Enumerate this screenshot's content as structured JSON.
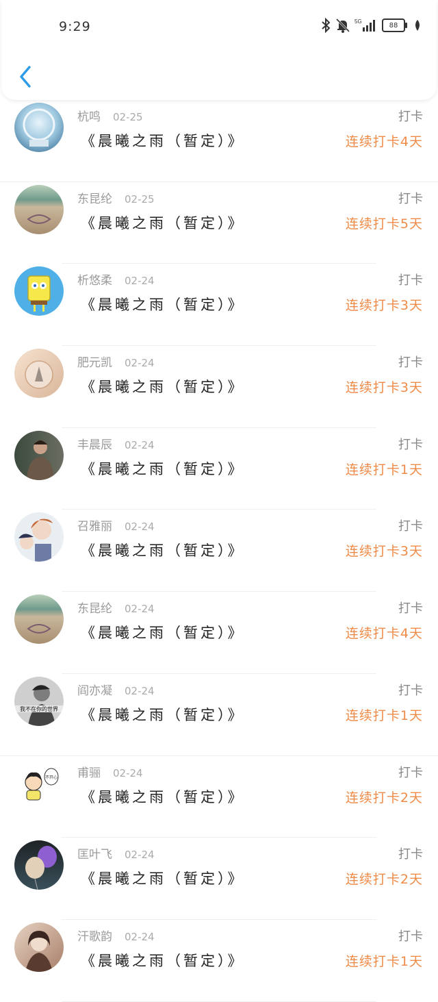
{
  "status_bar": {
    "time": "9:29",
    "network": "5G",
    "battery": "88"
  },
  "header": {
    "back_icon": "chevron-left-icon"
  },
  "colors": {
    "streak": "#ef8b48",
    "back": "#2e9be6"
  },
  "items": [
    {
      "name": "杭鸣",
      "date": "02-25",
      "title": "《晨曦之雨（暂定）》",
      "checkin": "打卡",
      "streak": "连续打卡4天",
      "avatar": "crystal-ball"
    },
    {
      "name": "东昆纶",
      "date": "02-25",
      "title": "《晨曦之雨（暂定）》",
      "checkin": "打卡",
      "streak": "连续打卡5天",
      "avatar": "beach-heart"
    },
    {
      "name": "析悠柔",
      "date": "02-24",
      "title": "《晨曦之雨（暂定）》",
      "checkin": "打卡",
      "streak": "连续打卡3天",
      "avatar": "sponge-cartoon"
    },
    {
      "name": "肥元凯",
      "date": "02-24",
      "title": "《晨曦之雨（暂定）》",
      "checkin": "打卡",
      "streak": "连续打卡3天",
      "avatar": "glass-jar"
    },
    {
      "name": "丰晨辰",
      "date": "02-24",
      "title": "《晨曦之雨（暂定）》",
      "checkin": "打卡",
      "streak": "连续打卡1天",
      "avatar": "man-portrait"
    },
    {
      "name": "召雅丽",
      "date": "02-24",
      "title": "《晨曦之雨（暂定）》",
      "checkin": "打卡",
      "streak": "连续打卡3天",
      "avatar": "anime-boys"
    },
    {
      "name": "东昆纶",
      "date": "02-24",
      "title": "《晨曦之雨（暂定）》",
      "checkin": "打卡",
      "streak": "连续打卡4天",
      "avatar": "beach-heart"
    },
    {
      "name": "阎亦凝",
      "date": "02-24",
      "title": "《晨曦之雨（暂定）》",
      "checkin": "打卡",
      "streak": "连续打卡1天",
      "avatar": "bw-portrait-text",
      "avatar_text": "我不在你的世界"
    },
    {
      "name": "甫骊",
      "date": "02-24",
      "title": "《晨曦之雨（暂定）》",
      "checkin": "打卡",
      "streak": "连续打卡2天",
      "avatar": "cartoon-girl",
      "avatar_text": "不开心"
    },
    {
      "name": "匡叶飞",
      "date": "02-24",
      "title": "《晨曦之雨（暂定）》",
      "checkin": "打卡",
      "streak": "连续打卡2天",
      "avatar": "balloons"
    },
    {
      "name": "汗歌韵",
      "date": "02-24",
      "title": "《晨曦之雨（暂定）》",
      "checkin": "打卡",
      "streak": "连续打卡1天",
      "avatar": "woman-portrait"
    }
  ]
}
